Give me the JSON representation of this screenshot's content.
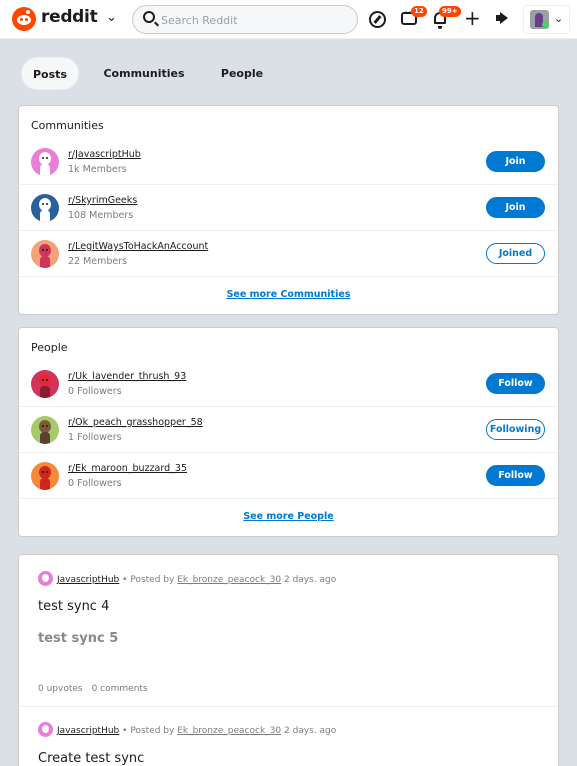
{
  "header": {
    "brand": "reddit",
    "search_placeholder": "Search Reddit",
    "chat_badge": "12",
    "notifications_badge": "99+"
  },
  "tabs": [
    {
      "label": "Posts"
    },
    {
      "label": "Communities"
    },
    {
      "label": "People"
    }
  ],
  "communities": {
    "title": "Communities",
    "items": [
      {
        "name": "r/JavascriptHub",
        "meta": "1k Members",
        "action": "Join",
        "color": "#e87ed8"
      },
      {
        "name": "r/SkyrimGeeks",
        "meta": "108 Members",
        "action": "Join",
        "color": "#2c5f9e"
      },
      {
        "name": "r/LegitWaysToHackAnAccount",
        "meta": "22 Members",
        "action": "Joined",
        "color": "#f5a27a"
      }
    ],
    "see_more": "See more Communities"
  },
  "people": {
    "title": "People",
    "items": [
      {
        "name": "r/Uk_lavender_thrush_93",
        "meta": "0 Followers",
        "action": "Follow",
        "color": "#d1345b"
      },
      {
        "name": "r/Ok_peach_grasshopper_58",
        "meta": "1 Followers",
        "action": "Following",
        "color": "#a6c96a"
      },
      {
        "name": "r/Ek_maroon_buzzard_35",
        "meta": "0 Followers",
        "action": "Follow",
        "color": "#f58a3c"
      }
    ],
    "see_more": "See more People"
  },
  "posts": [
    {
      "subreddit": "JavascriptHub",
      "posted_by_prefix": "• Posted by",
      "author": "Ek_bronze_peacock_30",
      "time": "2 days. ago",
      "title": "test sync 4",
      "body": "test sync 5",
      "upvotes": "0 upvotes",
      "comments": "0 comments"
    },
    {
      "subreddit": "JavascriptHub",
      "posted_by_prefix": "• Posted by",
      "author": "Ek_bronze_peacock_30",
      "time": "2 days. ago",
      "title": "Create test sync"
    }
  ]
}
